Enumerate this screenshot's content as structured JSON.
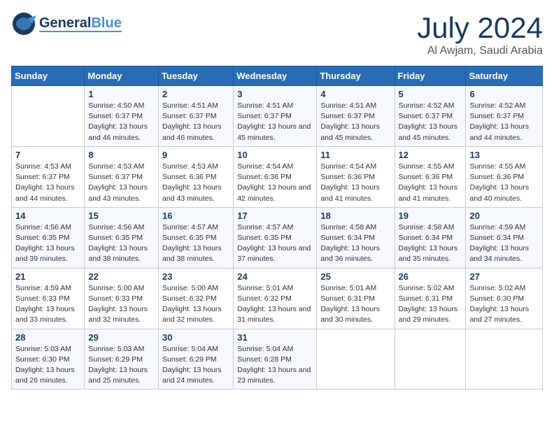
{
  "header": {
    "logo_general": "General",
    "logo_blue": "Blue",
    "title": "July 2024",
    "location": "Al Awjam, Saudi Arabia"
  },
  "columns": [
    "Sunday",
    "Monday",
    "Tuesday",
    "Wednesday",
    "Thursday",
    "Friday",
    "Saturday"
  ],
  "weeks": [
    [
      {
        "day": "",
        "sunrise": "",
        "sunset": "",
        "daylight": ""
      },
      {
        "day": "1",
        "sunrise": "Sunrise: 4:50 AM",
        "sunset": "Sunset: 6:37 PM",
        "daylight": "Daylight: 13 hours and 46 minutes."
      },
      {
        "day": "2",
        "sunrise": "Sunrise: 4:51 AM",
        "sunset": "Sunset: 6:37 PM",
        "daylight": "Daylight: 13 hours and 46 minutes."
      },
      {
        "day": "3",
        "sunrise": "Sunrise: 4:51 AM",
        "sunset": "Sunset: 6:37 PM",
        "daylight": "Daylight: 13 hours and 45 minutes."
      },
      {
        "day": "4",
        "sunrise": "Sunrise: 4:51 AM",
        "sunset": "Sunset: 6:37 PM",
        "daylight": "Daylight: 13 hours and 45 minutes."
      },
      {
        "day": "5",
        "sunrise": "Sunrise: 4:52 AM",
        "sunset": "Sunset: 6:37 PM",
        "daylight": "Daylight: 13 hours and 45 minutes."
      },
      {
        "day": "6",
        "sunrise": "Sunrise: 4:52 AM",
        "sunset": "Sunset: 6:37 PM",
        "daylight": "Daylight: 13 hours and 44 minutes."
      }
    ],
    [
      {
        "day": "7",
        "sunrise": "Sunrise: 4:53 AM",
        "sunset": "Sunset: 6:37 PM",
        "daylight": "Daylight: 13 hours and 44 minutes."
      },
      {
        "day": "8",
        "sunrise": "Sunrise: 4:53 AM",
        "sunset": "Sunset: 6:37 PM",
        "daylight": "Daylight: 13 hours and 43 minutes."
      },
      {
        "day": "9",
        "sunrise": "Sunrise: 4:53 AM",
        "sunset": "Sunset: 6:36 PM",
        "daylight": "Daylight: 13 hours and 43 minutes."
      },
      {
        "day": "10",
        "sunrise": "Sunrise: 4:54 AM",
        "sunset": "Sunset: 6:36 PM",
        "daylight": "Daylight: 13 hours and 42 minutes."
      },
      {
        "day": "11",
        "sunrise": "Sunrise: 4:54 AM",
        "sunset": "Sunset: 6:36 PM",
        "daylight": "Daylight: 13 hours and 41 minutes."
      },
      {
        "day": "12",
        "sunrise": "Sunrise: 4:55 AM",
        "sunset": "Sunset: 6:36 PM",
        "daylight": "Daylight: 13 hours and 41 minutes."
      },
      {
        "day": "13",
        "sunrise": "Sunrise: 4:55 AM",
        "sunset": "Sunset: 6:36 PM",
        "daylight": "Daylight: 13 hours and 40 minutes."
      }
    ],
    [
      {
        "day": "14",
        "sunrise": "Sunrise: 4:56 AM",
        "sunset": "Sunset: 6:35 PM",
        "daylight": "Daylight: 13 hours and 39 minutes."
      },
      {
        "day": "15",
        "sunrise": "Sunrise: 4:56 AM",
        "sunset": "Sunset: 6:35 PM",
        "daylight": "Daylight: 13 hours and 38 minutes."
      },
      {
        "day": "16",
        "sunrise": "Sunrise: 4:57 AM",
        "sunset": "Sunset: 6:35 PM",
        "daylight": "Daylight: 13 hours and 38 minutes."
      },
      {
        "day": "17",
        "sunrise": "Sunrise: 4:57 AM",
        "sunset": "Sunset: 6:35 PM",
        "daylight": "Daylight: 13 hours and 37 minutes."
      },
      {
        "day": "18",
        "sunrise": "Sunrise: 4:58 AM",
        "sunset": "Sunset: 6:34 PM",
        "daylight": "Daylight: 13 hours and 36 minutes."
      },
      {
        "day": "19",
        "sunrise": "Sunrise: 4:58 AM",
        "sunset": "Sunset: 6:34 PM",
        "daylight": "Daylight: 13 hours and 35 minutes."
      },
      {
        "day": "20",
        "sunrise": "Sunrise: 4:59 AM",
        "sunset": "Sunset: 6:34 PM",
        "daylight": "Daylight: 13 hours and 34 minutes."
      }
    ],
    [
      {
        "day": "21",
        "sunrise": "Sunrise: 4:59 AM",
        "sunset": "Sunset: 6:33 PM",
        "daylight": "Daylight: 13 hours and 33 minutes."
      },
      {
        "day": "22",
        "sunrise": "Sunrise: 5:00 AM",
        "sunset": "Sunset: 6:33 PM",
        "daylight": "Daylight: 13 hours and 32 minutes."
      },
      {
        "day": "23",
        "sunrise": "Sunrise: 5:00 AM",
        "sunset": "Sunset: 6:32 PM",
        "daylight": "Daylight: 13 hours and 32 minutes."
      },
      {
        "day": "24",
        "sunrise": "Sunrise: 5:01 AM",
        "sunset": "Sunset: 6:32 PM",
        "daylight": "Daylight: 13 hours and 31 minutes."
      },
      {
        "day": "25",
        "sunrise": "Sunrise: 5:01 AM",
        "sunset": "Sunset: 6:31 PM",
        "daylight": "Daylight: 13 hours and 30 minutes."
      },
      {
        "day": "26",
        "sunrise": "Sunrise: 5:02 AM",
        "sunset": "Sunset: 6:31 PM",
        "daylight": "Daylight: 13 hours and 29 minutes."
      },
      {
        "day": "27",
        "sunrise": "Sunrise: 5:02 AM",
        "sunset": "Sunset: 6:30 PM",
        "daylight": "Daylight: 13 hours and 27 minutes."
      }
    ],
    [
      {
        "day": "28",
        "sunrise": "Sunrise: 5:03 AM",
        "sunset": "Sunset: 6:30 PM",
        "daylight": "Daylight: 13 hours and 26 minutes."
      },
      {
        "day": "29",
        "sunrise": "Sunrise: 5:03 AM",
        "sunset": "Sunset: 6:29 PM",
        "daylight": "Daylight: 13 hours and 25 minutes."
      },
      {
        "day": "30",
        "sunrise": "Sunrise: 5:04 AM",
        "sunset": "Sunset: 6:29 PM",
        "daylight": "Daylight: 13 hours and 24 minutes."
      },
      {
        "day": "31",
        "sunrise": "Sunrise: 5:04 AM",
        "sunset": "Sunset: 6:28 PM",
        "daylight": "Daylight: 13 hours and 23 minutes."
      },
      {
        "day": "",
        "sunrise": "",
        "sunset": "",
        "daylight": ""
      },
      {
        "day": "",
        "sunrise": "",
        "sunset": "",
        "daylight": ""
      },
      {
        "day": "",
        "sunrise": "",
        "sunset": "",
        "daylight": ""
      }
    ]
  ]
}
